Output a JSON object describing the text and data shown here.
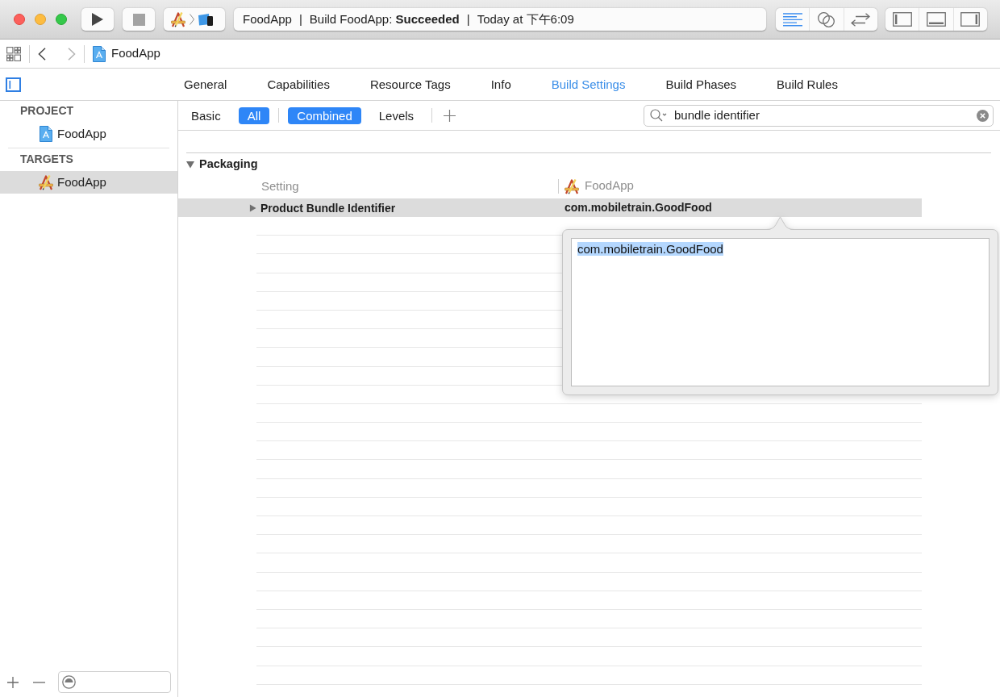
{
  "toolbar": {
    "stop_disabled": true
  },
  "activity_view": {
    "segments": [
      {
        "kind": "text",
        "text": "FoodApp"
      },
      {
        "kind": "separator",
        "text": "|"
      },
      {
        "kind": "text",
        "text": "Build FoodApp: **Succeeded**"
      },
      {
        "kind": "separator",
        "text": "|"
      },
      {
        "kind": "text",
        "text": "Today at 下午6:09"
      }
    ]
  },
  "editor_modes": [
    {
      "kind": "standard",
      "selected": true
    },
    {
      "kind": "assistant",
      "selected": false
    },
    {
      "kind": "version",
      "selected": false
    }
  ],
  "panel_toggles": [
    {
      "kind": "navigator"
    },
    {
      "kind": "debug"
    },
    {
      "kind": "utilities"
    }
  ],
  "jump_bar": {
    "back_disabled": false,
    "forward_disabled": true,
    "path": [
      "FoodApp"
    ]
  },
  "tabs": [
    {
      "label": "General",
      "selected": false
    },
    {
      "label": "Capabilities",
      "selected": false
    },
    {
      "label": "Resource Tags",
      "selected": false
    },
    {
      "label": "Info",
      "selected": false
    },
    {
      "label": "Build Settings",
      "selected": true
    },
    {
      "label": "Build Phases",
      "selected": false
    },
    {
      "label": "Build Rules",
      "selected": false
    }
  ],
  "sidebar": {
    "sections": [
      {
        "header": "PROJECT",
        "items": [
          {
            "kind": "project",
            "label": "FoodApp",
            "selected": false
          }
        ]
      },
      {
        "header": "TARGETS",
        "items": [
          {
            "kind": "target",
            "label": "FoodApp",
            "selected": true
          }
        ]
      }
    ]
  },
  "filter_bar": {
    "scopes": [
      {
        "label": "Basic",
        "selected": false
      },
      {
        "label": "All",
        "selected": true
      }
    ],
    "views": [
      {
        "label": "Combined",
        "selected": true
      },
      {
        "label": "Levels",
        "selected": false
      }
    ],
    "search": {
      "value": "bundle identifier"
    }
  },
  "settings": {
    "sections": [
      {
        "title": "Packaging",
        "expanded": true,
        "columns": [
          "Setting",
          "FoodApp"
        ],
        "rows": [
          {
            "name": "Product Bundle Identifier",
            "value": "com.mobiletrain.GoodFood",
            "selected": true,
            "expanded": false
          }
        ]
      }
    ]
  },
  "popover": {
    "value": "com.mobiletrain.GoodFood",
    "text_selected": true
  }
}
